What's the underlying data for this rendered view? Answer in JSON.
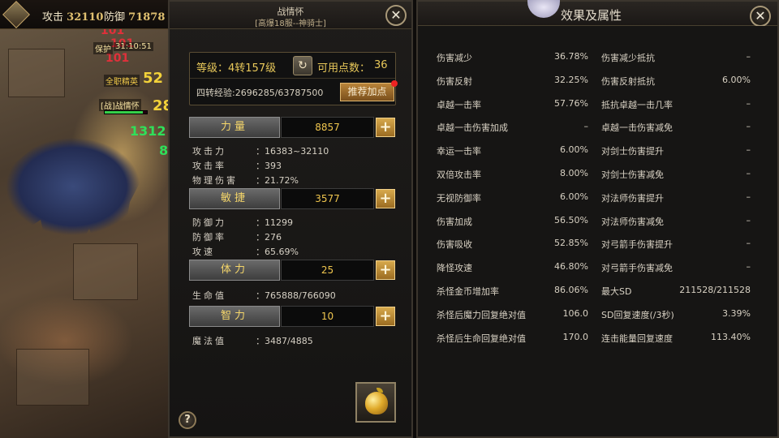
{
  "hud": {
    "attack_label": "攻击",
    "attack_value": "32110",
    "defense_label": "防御",
    "defense_value": "71878"
  },
  "scene": {
    "dmg_red_1": "101",
    "dmg_red_2": "101",
    "dmg_red_3": "101",
    "dmg_yellow": "52",
    "dmg_yellow_2": "28",
    "dmg_green": "1312",
    "dmg_green_2": "8",
    "tag_protect": "保护",
    "tag_time": "31:10:51",
    "tag_title": "全职精英",
    "tag_name": "[战]战情怀"
  },
  "left_panel": {
    "title": "战情怀",
    "subtitle": "[高爆18服--神骑士]",
    "level_text": "等级：4转157级",
    "points_label": "可用点数：",
    "points_value": "36",
    "exp_text": "四转经验:2696285/63787500",
    "recommend_label": "推荐加点",
    "stats": [
      {
        "name": "力量",
        "value": "8857"
      },
      {
        "name": "敏捷",
        "value": "3577"
      },
      {
        "name": "体力",
        "value": "25"
      },
      {
        "name": "智力",
        "value": "10"
      }
    ],
    "derived": {
      "str": [
        {
          "k": "攻击力",
          "v": "：16383~32110"
        },
        {
          "k": "攻击率",
          "v": "：393"
        },
        {
          "k": "物理伤害",
          "v": "：21.72%"
        }
      ],
      "agi": [
        {
          "k": "防御力",
          "v": "：11299"
        },
        {
          "k": "防御率",
          "v": "：276"
        },
        {
          "k": "攻速",
          "v": "：65.69%"
        }
      ],
      "vit": [
        {
          "k": "生命值",
          "v": "：765888/766090"
        }
      ],
      "int": [
        {
          "k": "魔法值",
          "v": "：3487/4885"
        }
      ]
    },
    "help_label": "?"
  },
  "right_panel": {
    "title": "效果及属性",
    "left_col": [
      {
        "k": "伤害减少",
        "v": "36.78%"
      },
      {
        "k": "伤害反射",
        "v": "32.25%"
      },
      {
        "k": "卓越一击率",
        "v": "57.76%"
      },
      {
        "k": "卓越一击伤害加成",
        "v": "–"
      },
      {
        "k": "幸运一击率",
        "v": "6.00%"
      },
      {
        "k": "双倍攻击率",
        "v": "8.00%"
      },
      {
        "k": "无视防御率",
        "v": "6.00%"
      },
      {
        "k": "伤害加成",
        "v": "56.50%"
      },
      {
        "k": "伤害吸收",
        "v": "52.85%"
      },
      {
        "k": "降怪攻速",
        "v": "46.80%"
      },
      {
        "k": "杀怪金币增加率",
        "v": "86.06%"
      },
      {
        "k": "杀怪后魔力回复绝对值",
        "v": "106.0"
      },
      {
        "k": "杀怪后生命回复绝对值",
        "v": "170.0"
      }
    ],
    "right_col": [
      {
        "k": "伤害减少抵抗",
        "v": "–"
      },
      {
        "k": "伤害反射抵抗",
        "v": "6.00%"
      },
      {
        "k": "抵抗卓越一击几率",
        "v": "–"
      },
      {
        "k": "卓越一击伤害减免",
        "v": "–"
      },
      {
        "k": "对剑士伤害提升",
        "v": "–"
      },
      {
        "k": "对剑士伤害减免",
        "v": "–"
      },
      {
        "k": "对法师伤害提升",
        "v": "–"
      },
      {
        "k": "对法师伤害减免",
        "v": "–"
      },
      {
        "k": "对弓箭手伤害提升",
        "v": "–"
      },
      {
        "k": "对弓箭手伤害减免",
        "v": "–"
      },
      {
        "k": "最大SD",
        "v": "211528/211528"
      },
      {
        "k": "SD回复速度(/3秒)",
        "v": "3.39%"
      },
      {
        "k": "连击能量回复速度",
        "v": "113.40%"
      }
    ]
  },
  "close_label": "✕",
  "plus_label": "+",
  "refresh_icon": "↻"
}
